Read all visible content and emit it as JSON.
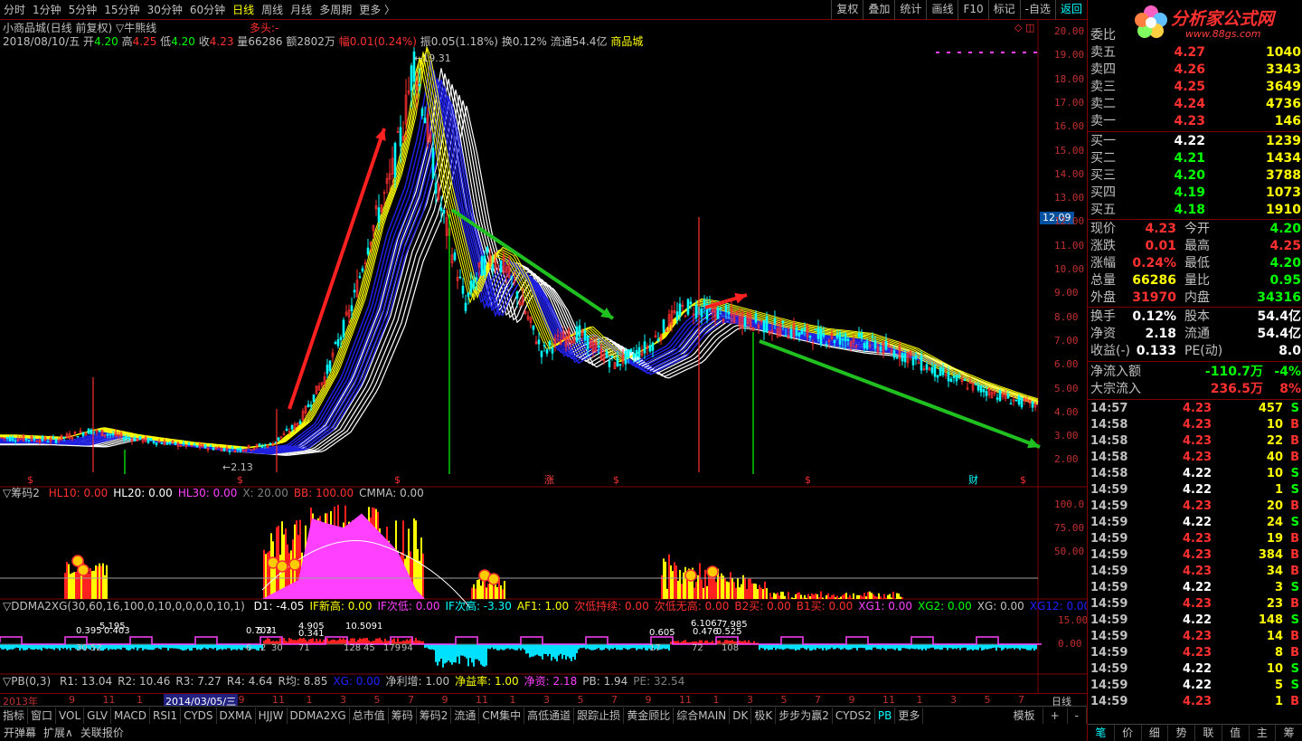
{
  "toolbar": {
    "periods": [
      "分时",
      "1分钟",
      "5分钟",
      "15分钟",
      "30分钟",
      "60分钟",
      "日线",
      "周线",
      "月线",
      "多周期",
      "更多"
    ],
    "active_period": "日线",
    "actions": [
      "复权",
      "叠加",
      "统计",
      "画线",
      "F10",
      "标记",
      "-自选",
      "返回"
    ]
  },
  "stock": {
    "title": "小商品城(日线 前复权)",
    "indicator_name": "牛熊线",
    "trend_label": "多头:-",
    "date": "2018/08/10/五",
    "open": "4.20",
    "high": "4.25",
    "low": "4.20",
    "close": "4.23",
    "volume": "66286",
    "amount": "2802万",
    "change": "0.01(0.24%)",
    "amplitude": "0.05(1.18%)",
    "turnover": "0.12%",
    "float_cap": "流通54.4亿",
    "name": "商品城",
    "high_mark": "19.31",
    "low_mark": "2.13",
    "current_marker": "12.09",
    "zhang_mark": "涨",
    "cai_mark": "财"
  },
  "price_axis": [
    "20.00",
    "19.00",
    "18.00",
    "17.00",
    "16.00",
    "15.00",
    "14.00",
    "13.00",
    "12.00",
    "11.00",
    "10.00",
    "9.00",
    "8.00",
    "7.00",
    "6.00",
    "5.00",
    "4.00",
    "3.00",
    "2.00"
  ],
  "panel2": {
    "name": "筹码2",
    "values": [
      {
        "label": "HL10: 0.00",
        "color": "#ff3030"
      },
      {
        "label": "HL20: 0.00",
        "color": "#ffffff"
      },
      {
        "label": "HL30: 0.00",
        "color": "#ff40ff"
      },
      {
        "label": "X: 20.00",
        "color": "#808080"
      },
      {
        "label": "BB: 100.00",
        "color": "#ff3030"
      },
      {
        "label": "CMMA: 0.00",
        "color": "#c0c0c0"
      }
    ],
    "axis": [
      "100.0",
      "75.00",
      "50.00"
    ]
  },
  "panel3": {
    "name": "DDMA2XG(30,60,16,100,0,10,0,0,0,0,10,1)",
    "values": [
      {
        "label": "D1: -4.05",
        "color": "#ffffff"
      },
      {
        "label": "IF新高: 0.00",
        "color": "#ffff00"
      },
      {
        "label": "IF次低: 0.00",
        "color": "#ff40ff"
      },
      {
        "label": "IF次高: -3.30",
        "color": "#00ffff"
      },
      {
        "label": "AF1: 1.00",
        "color": "#ffff00"
      },
      {
        "label": "次低持续: 0.00",
        "color": "#ff3030"
      },
      {
        "label": "次低无高: 0.00",
        "color": "#ff3030"
      },
      {
        "label": "B2买: 0.00",
        "color": "#ff3030"
      },
      {
        "label": "B1买: 0.00",
        "color": "#ff3030"
      },
      {
        "label": "XG1: 0.00",
        "color": "#ff40ff"
      },
      {
        "label": "XG2: 0.00",
        "color": "#00ff00"
      },
      {
        "label": "XG: 0.00",
        "color": "#c0c0c0"
      },
      {
        "label": "XG12: 0.00",
        "color": "#2020ff"
      }
    ],
    "axis": [
      "15.00",
      "0.00"
    ],
    "annotations": [
      "0.395",
      "5.195",
      "0.403",
      "0.703",
      "5.71",
      "4.905",
      "10.5091",
      "0.341",
      "0.605",
      "6.1067",
      "7.985",
      "0.476",
      "0.525",
      "30",
      "52",
      "6",
      "2",
      "30",
      "71",
      "128",
      "45",
      "179",
      "94",
      "17",
      "72",
      "108"
    ]
  },
  "panel4": {
    "name": "PB(0,3)",
    "values": [
      {
        "label": "R1: 13.04",
        "color": "#c0c0c0"
      },
      {
        "label": "R2: 10.46",
        "color": "#c0c0c0"
      },
      {
        "label": "R3: 7.27",
        "color": "#c0c0c0"
      },
      {
        "label": "R4: 4.64",
        "color": "#c0c0c0"
      },
      {
        "label": "R均: 8.85",
        "color": "#c0c0c0"
      },
      {
        "label": "XG: 0.00",
        "color": "#2020ff"
      },
      {
        "label": "净利增: 1.00",
        "color": "#c0c0c0"
      },
      {
        "label": "净益率: 1.00",
        "color": "#ffff00"
      },
      {
        "label": "净资: 2.18",
        "color": "#ff40ff"
      },
      {
        "label": "PB: 1.94",
        "color": "#c0c0c0"
      },
      {
        "label": "PE: 32.54",
        "color": "#808080"
      }
    ]
  },
  "date_axis": {
    "year_label": "2013年",
    "cursor_date": "2014/03/05/三",
    "months": [
      "9",
      "11",
      "1",
      "5",
      "7",
      "9",
      "11",
      "1",
      "3",
      "5",
      "7",
      "9",
      "11",
      "1",
      "3",
      "5",
      "7",
      "9",
      "11",
      "1",
      "3",
      "5",
      "7",
      "9",
      "11",
      "1",
      "3",
      "5",
      "7"
    ],
    "period": "日线"
  },
  "indicator_tabs": [
    "指标",
    "窗口",
    "VOL",
    "GLV",
    "MACD",
    "RSI1",
    "CYDS",
    "DXMA",
    "HJJW",
    "DDMA2XG",
    "总市值",
    "筹码",
    "筹码2",
    "流通",
    "CM集中",
    "高低通道",
    "跟踪止损",
    "黄金顾比",
    "综合MAIN",
    "DK",
    "极K",
    "步步为赢2",
    "CYDS2",
    "PB",
    "更多"
  ],
  "active_tab": "PB",
  "tabbar_right": [
    "模板",
    "+",
    "-"
  ],
  "status": [
    "开弹幕",
    "扩展∧",
    "关联报价"
  ],
  "logo": {
    "title": "分析家公式网",
    "url": "www.88gs.com"
  },
  "orderbook": {
    "header": "委比",
    "asks": [
      {
        "label": "卖五",
        "price": "4.27",
        "vol": "1040"
      },
      {
        "label": "卖四",
        "price": "4.26",
        "vol": "3343"
      },
      {
        "label": "卖三",
        "price": "4.25",
        "vol": "3649"
      },
      {
        "label": "卖二",
        "price": "4.24",
        "vol": "4736"
      },
      {
        "label": "卖一",
        "price": "4.23",
        "vol": "146"
      }
    ],
    "bids": [
      {
        "label": "买一",
        "price": "4.22",
        "vol": "1239",
        "color": "#ffffff"
      },
      {
        "label": "买二",
        "price": "4.21",
        "vol": "1434",
        "color": "#00ff00"
      },
      {
        "label": "买三",
        "price": "4.20",
        "vol": "3788",
        "color": "#00ff00"
      },
      {
        "label": "买四",
        "price": "4.19",
        "vol": "1073",
        "color": "#00ff00"
      },
      {
        "label": "买五",
        "price": "4.18",
        "vol": "1910",
        "color": "#00ff00"
      }
    ]
  },
  "quote": [
    {
      "k1": "现价",
      "a1": "4.23",
      "c1": "#ff3030",
      "k2": "今开",
      "a2": "4.20",
      "c2": "#00ff00"
    },
    {
      "k1": "涨跌",
      "a1": "0.01",
      "c1": "#ff3030",
      "k2": "最高",
      "a2": "4.25",
      "c2": "#ff3030"
    },
    {
      "k1": "涨幅",
      "a1": "0.24%",
      "c1": "#ff3030",
      "k2": "最低",
      "a2": "4.20",
      "c2": "#00ff00"
    },
    {
      "k1": "总量",
      "a1": "66286",
      "c1": "#ffff00",
      "k2": "量比",
      "a2": "0.95",
      "c2": "#00ff00"
    },
    {
      "k1": "外盘",
      "a1": "31970",
      "c1": "#ff3030",
      "k2": "内盘",
      "a2": "34316",
      "c2": "#00ff00"
    }
  ],
  "fundamentals": [
    {
      "k1": "换手",
      "a1": "0.12%",
      "k2": "股本",
      "a2": "54.4亿"
    },
    {
      "k1": "净资",
      "a1": "2.18",
      "k2": "流通",
      "a2": "54.4亿"
    },
    {
      "k1": "收益(-)",
      "a1": "0.133",
      "k2": "PE(动)",
      "a2": "8.0"
    }
  ],
  "flows": [
    {
      "label": "净流入额",
      "value": "-110.7万",
      "pct": "-4%",
      "color": "#00ff00"
    },
    {
      "label": "大宗流入",
      "value": "236.5万",
      "pct": "8%",
      "color": "#ff3030"
    }
  ],
  "ticks": [
    {
      "t": "14:57",
      "p": "4.23",
      "q": "457",
      "s": "S"
    },
    {
      "t": "14:58",
      "p": "4.23",
      "q": "10",
      "s": "B"
    },
    {
      "t": "14:58",
      "p": "4.23",
      "q": "22",
      "s": "B"
    },
    {
      "t": "14:58",
      "p": "4.23",
      "q": "40",
      "s": "B"
    },
    {
      "t": "14:58",
      "p": "4.22",
      "q": "10",
      "s": "S"
    },
    {
      "t": "14:59",
      "p": "4.22",
      "q": "1",
      "s": "S"
    },
    {
      "t": "14:59",
      "p": "4.23",
      "q": "20",
      "s": "B"
    },
    {
      "t": "14:59",
      "p": "4.22",
      "q": "24",
      "s": "S"
    },
    {
      "t": "14:59",
      "p": "4.23",
      "q": "19",
      "s": "B"
    },
    {
      "t": "14:59",
      "p": "4.23",
      "q": "384",
      "s": "B"
    },
    {
      "t": "14:59",
      "p": "4.23",
      "q": "34",
      "s": "B"
    },
    {
      "t": "14:59",
      "p": "4.22",
      "q": "3",
      "s": "S"
    },
    {
      "t": "14:59",
      "p": "4.23",
      "q": "23",
      "s": "B"
    },
    {
      "t": "14:59",
      "p": "4.22",
      "q": "148",
      "s": "S"
    },
    {
      "t": "14:59",
      "p": "4.23",
      "q": "14",
      "s": "B"
    },
    {
      "t": "14:59",
      "p": "4.23",
      "q": "8",
      "s": "B"
    },
    {
      "t": "14:59",
      "p": "4.22",
      "q": "10",
      "s": "S"
    },
    {
      "t": "14:59",
      "p": "4.22",
      "q": "5",
      "s": "S"
    },
    {
      "t": "14:59",
      "p": "4.23",
      "q": "1",
      "s": "B"
    }
  ],
  "rp_tabs": [
    "笔",
    "价",
    "细",
    "势",
    "联",
    "值",
    "主",
    "筹"
  ],
  "colors": {
    "up": "#ff3030",
    "down": "#00ff00",
    "cyan": "#00ffff",
    "yellow": "#ffff00",
    "magenta": "#ff40ff",
    "frame": "#800000"
  }
}
